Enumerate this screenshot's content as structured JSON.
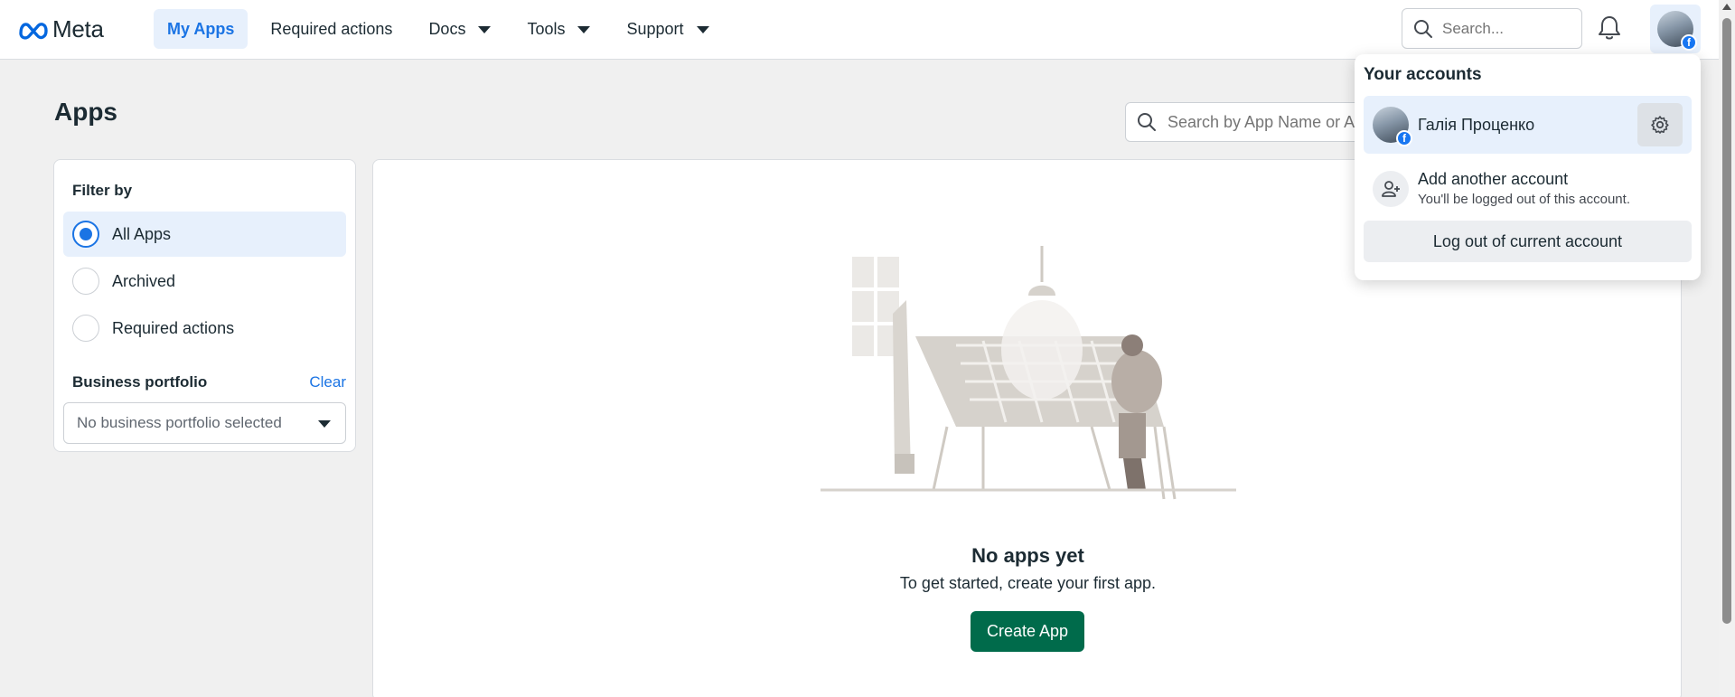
{
  "header": {
    "logo_text": "Meta",
    "nav": [
      {
        "label": "My Apps",
        "active": true,
        "has_caret": false
      },
      {
        "label": "Required actions",
        "active": false,
        "has_caret": false
      },
      {
        "label": "Docs",
        "active": false,
        "has_caret": true
      },
      {
        "label": "Tools",
        "active": false,
        "has_caret": true
      },
      {
        "label": "Support",
        "active": false,
        "has_caret": true
      }
    ],
    "search_placeholder": "Search...",
    "icons": [
      "search-icon",
      "bell-icon",
      "avatar"
    ]
  },
  "page": {
    "title": "Apps",
    "app_search_placeholder": "Search by App Name or App ID"
  },
  "filter": {
    "title": "Filter by",
    "options": [
      {
        "label": "All Apps",
        "selected": true
      },
      {
        "label": "Archived",
        "selected": false
      },
      {
        "label": "Required actions",
        "selected": false
      }
    ],
    "business_portfolio_label": "Business portfolio",
    "clear_label": "Clear",
    "business_portfolio_value": "No business portfolio selected"
  },
  "empty_state": {
    "title": "No apps yet",
    "subtitle": "To get started, create your first app.",
    "button_label": "Create App"
  },
  "account_menu": {
    "title": "Your accounts",
    "current_account": "Галія Проценко",
    "add_account_title": "Add another account",
    "add_account_subtitle": "You'll be logged out of this account.",
    "logout_label": "Log out of current account"
  },
  "colors": {
    "accent": "#1b74e4",
    "selected_bg": "#e7f0fc",
    "primary_button": "#006b4b"
  }
}
